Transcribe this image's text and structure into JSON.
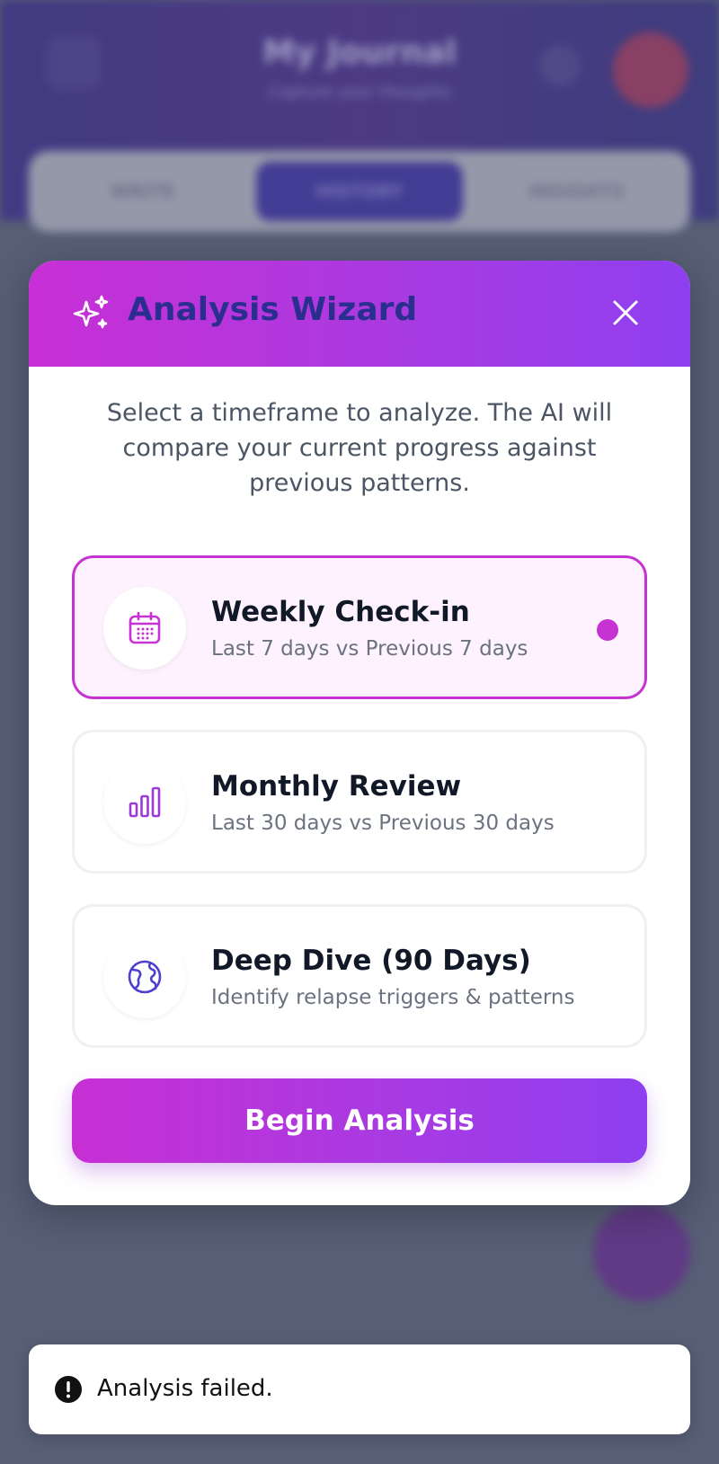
{
  "background": {
    "app_title": "My Journal",
    "app_subtitle": "Capture your thoughts",
    "tabs": [
      {
        "label": "WRITE"
      },
      {
        "label": "HISTORY"
      },
      {
        "label": "INSIGHTS"
      }
    ],
    "active_tab_index": 1
  },
  "modal": {
    "title": "Analysis Wizard",
    "title_icon": "sparkles-icon",
    "close_icon": "close-icon",
    "description": "Select a timeframe to analyze. The AI will compare your current progress against previous patterns.",
    "options": [
      {
        "title": "Weekly Check-in",
        "subtitle": "Last 7 days vs Previous 7 days",
        "icon": "calendar-icon",
        "selected": true
      },
      {
        "title": "Monthly Review",
        "subtitle": "Last 30 days vs Previous 30 days",
        "icon": "bar-chart-icon",
        "selected": false
      },
      {
        "title": "Deep Dive (90 Days)",
        "subtitle": "Identify relapse triggers & patterns",
        "icon": "globe-icon",
        "selected": false
      }
    ],
    "primary_button": "Begin Analysis"
  },
  "toast": {
    "icon": "alert-circle-icon",
    "message": "Analysis failed."
  },
  "colors": {
    "accent": "#c733d3",
    "header_gradient_start": "#c82fd6",
    "header_gradient_end": "#8f3ff0",
    "title_color": "#2a2f8f"
  }
}
